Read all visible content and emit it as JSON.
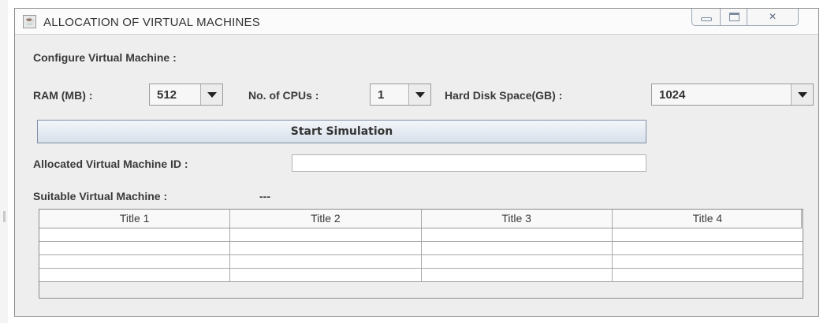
{
  "window": {
    "title": "ALLOCATION OF VIRTUAL MACHINES",
    "app_icon": "java-cup-icon",
    "controls": [
      "minimize-icon",
      "maximize-icon",
      "close-icon"
    ]
  },
  "config": {
    "heading": "Configure Virtual Machine :",
    "ram_label": "RAM (MB) :",
    "ram_value": "512",
    "cpu_label": "No. of CPUs :",
    "cpu_value": "1",
    "disk_label": "Hard Disk Space(GB) :",
    "disk_value": "1024"
  },
  "start_button": "Start Simulation",
  "allocated": {
    "label": "Allocated Virtual Machine ID :",
    "value": ""
  },
  "suitable": {
    "label": "Suitable Virtual Machine :",
    "value": "---"
  },
  "table": {
    "columns": [
      "Title 1",
      "Title 2",
      "Title 3",
      "Title 4"
    ],
    "rows": [
      [
        "",
        "",
        "",
        ""
      ],
      [
        "",
        "",
        "",
        ""
      ],
      [
        "",
        "",
        "",
        ""
      ],
      [
        "",
        "",
        "",
        ""
      ]
    ]
  }
}
